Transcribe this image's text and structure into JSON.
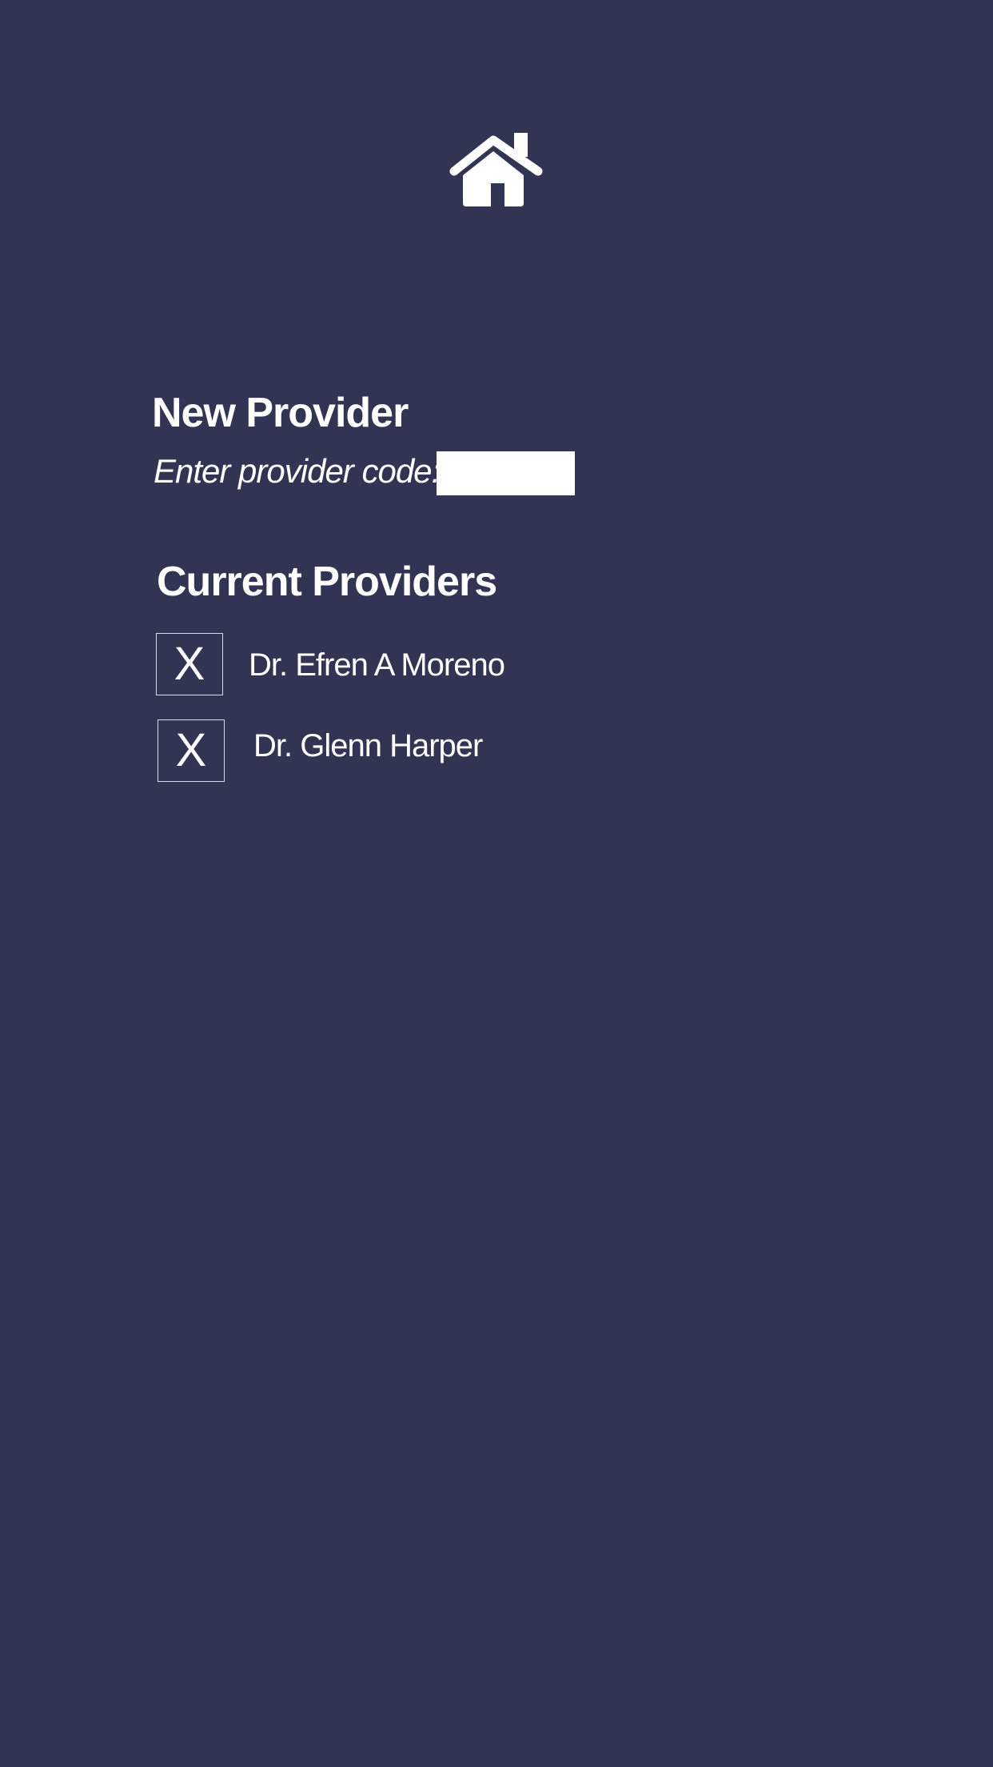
{
  "header": {
    "home_icon": "home-icon"
  },
  "new_provider": {
    "title": "New Provider",
    "code_label": "Enter provider code:",
    "code_value": "",
    "code_placeholder": ""
  },
  "current_providers": {
    "title": "Current Providers",
    "items": [
      {
        "remove_label": "X",
        "name": "Dr. Efren A Moreno"
      },
      {
        "remove_label": "X",
        "name": "Dr. Glenn Harper"
      }
    ]
  },
  "colors": {
    "background": "#323454",
    "text": "#ffffff",
    "input_background": "#ffffff",
    "button_border": "#d9dae6"
  }
}
